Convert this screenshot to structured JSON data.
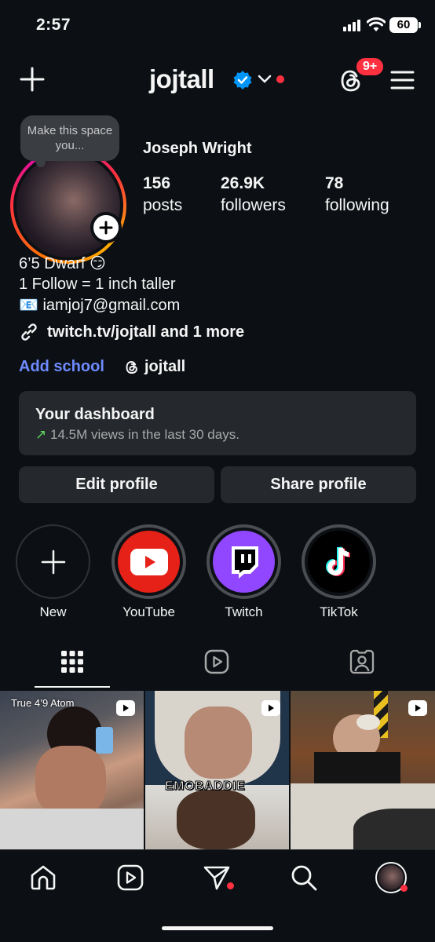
{
  "status_bar": {
    "time": "2:57",
    "battery": "60"
  },
  "header": {
    "username": "jojtall",
    "notification_badge": "9+"
  },
  "profile": {
    "note": "Make this space you...",
    "full_name": "Joseph Wright",
    "stats": [
      {
        "value": "156",
        "label": "posts"
      },
      {
        "value": "26.9K",
        "label": "followers"
      },
      {
        "value": "78",
        "label": "following"
      }
    ],
    "bio": [
      "6’5 Dwarf 😏",
      "1 Follow = 1 inch taller",
      "📧 iamjoj7@gmail.com"
    ],
    "link": "twitch.tv/jojtall and 1 more",
    "add_school": "Add school",
    "threads_handle": "jojtall"
  },
  "dashboard": {
    "title": "Your dashboard",
    "arrow": "↗",
    "subtitle": "14.5M views in the last 30 days."
  },
  "buttons": {
    "edit": "Edit profile",
    "share": "Share profile"
  },
  "highlights": [
    {
      "label": "New"
    },
    {
      "label": "YouTube"
    },
    {
      "label": "Twitch"
    },
    {
      "label": "TikTok"
    }
  ],
  "grid": {
    "tile1_caption": "True 4’9 Atom",
    "tile2_caption": "EMOBADDIE"
  },
  "colors": {
    "background": "#0c1014",
    "surface": "#25292e",
    "link_blue": "#6e8bff",
    "notification_red": "#ff3040",
    "verified_blue": "#0095f6"
  }
}
